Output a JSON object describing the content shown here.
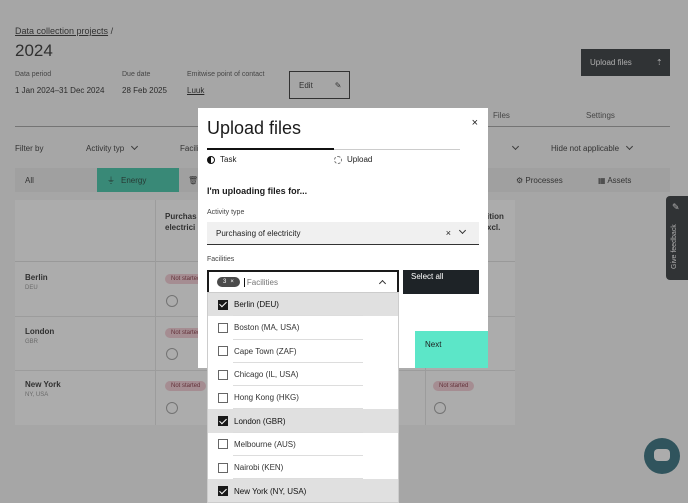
{
  "header": {
    "breadcrumb": "Data collection projects",
    "breadcrumb_sep": "/",
    "title": "2024",
    "upload_button": "Upload files",
    "edit_button": "Edit"
  },
  "meta": {
    "period_label": "Data period",
    "period_value": "1 Jan 2024–31 Dec 2024",
    "due_label": "Due date",
    "due_value": "28 Feb 2025",
    "contact_label": "Emitwise point of contact",
    "contact_value": "Luuk"
  },
  "tabs": [
    "Files",
    "Settings"
  ],
  "filters": {
    "label": "Filter by",
    "activity": "Activity typ",
    "facility": "Facili",
    "hide": "Hide not applicable"
  },
  "categories": {
    "all": "All",
    "energy": "Energy",
    "processes": "Processes",
    "assets": "Assets"
  },
  "table": {
    "col1": "Purchas electrici",
    "col3": "ition xcl.",
    "rows": [
      {
        "name": "Berlin",
        "code": "DEU",
        "status": "Not started"
      },
      {
        "name": "London",
        "code": "GBR",
        "status": "Not started"
      },
      {
        "name": "New York",
        "code": "NY, USA",
        "status": "Not started",
        "status2": "Not started"
      }
    ]
  },
  "feedback": "Give feedback",
  "modal": {
    "title": "Upload files",
    "close": "×",
    "steps": [
      "Task",
      "Upload"
    ],
    "subtitle": "I'm uploading files for...",
    "activity_label": "Activity type",
    "activity_value": "Purchasing of electricity",
    "activity_clear": "×",
    "facilities_label": "Facilities",
    "facilities_placeholder": "Facilities",
    "chip_count": "3",
    "chip_close": "×",
    "select_all": "Select all",
    "next": "Next"
  },
  "facility_options": [
    {
      "label": "Berlin (DEU)",
      "checked": true
    },
    {
      "label": "Boston (MA, USA)",
      "checked": false
    },
    {
      "label": "Cape Town (ZAF)",
      "checked": false
    },
    {
      "label": "Chicago (IL, USA)",
      "checked": false
    },
    {
      "label": "Hong Kong (HKG)",
      "checked": false
    },
    {
      "label": "London (GBR)",
      "checked": true
    },
    {
      "label": "Melbourne (AUS)",
      "checked": false
    },
    {
      "label": "Nairobi (KEN)",
      "checked": false
    },
    {
      "label": "New York (NY, USA)",
      "checked": true
    }
  ]
}
